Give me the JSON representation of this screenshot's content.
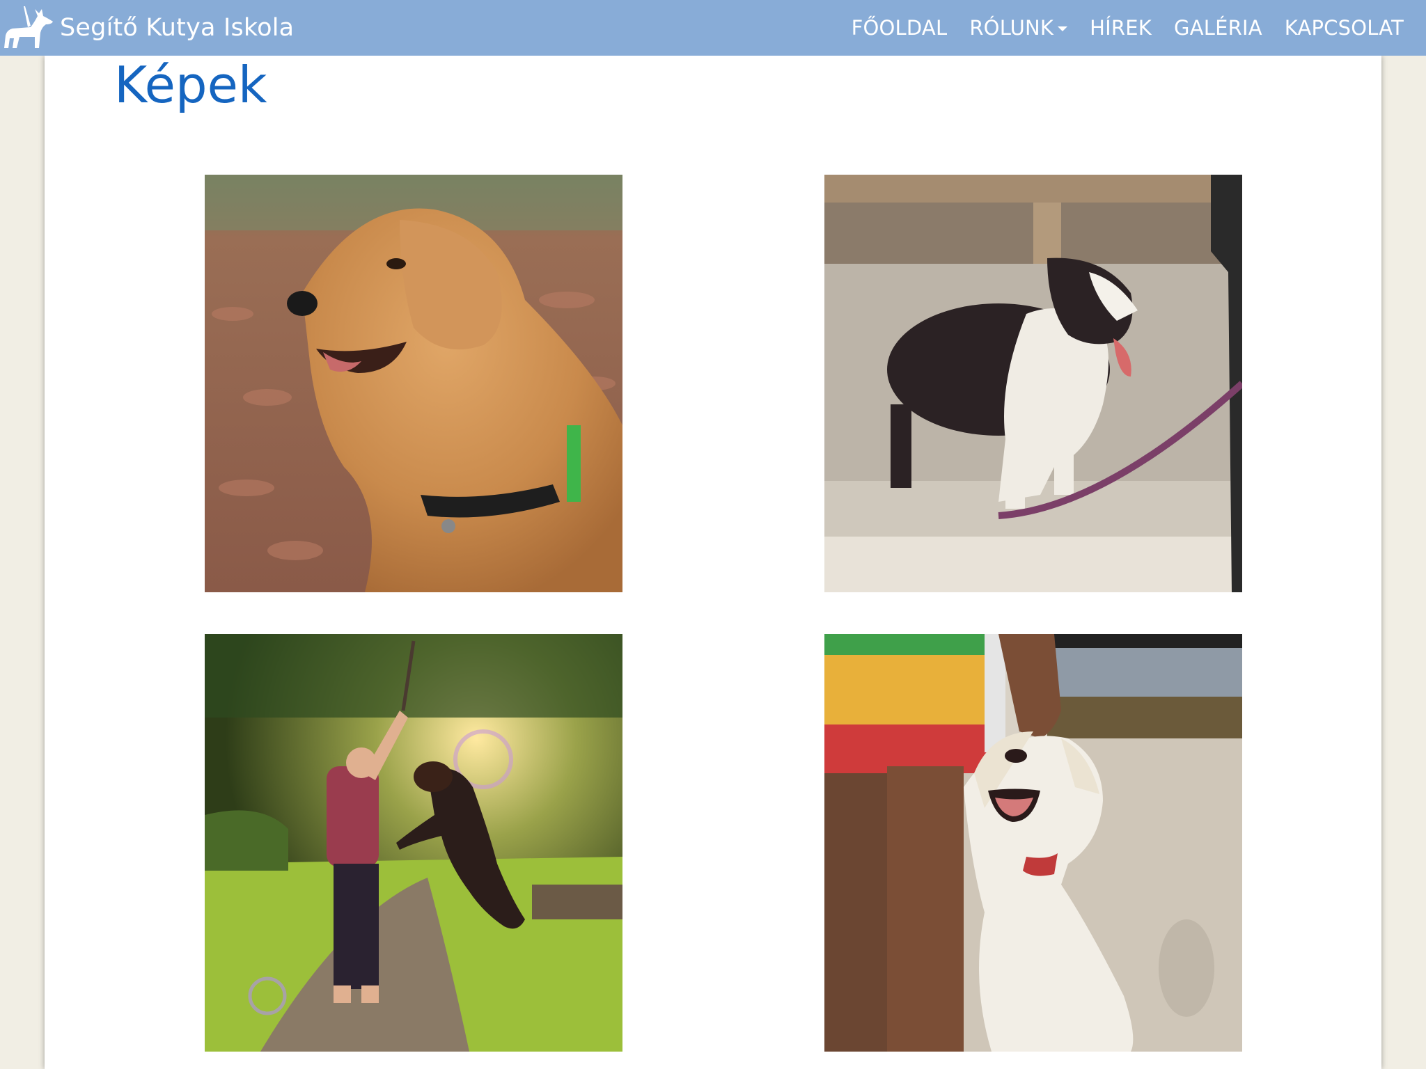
{
  "brand": {
    "name": "Segítő Kutya Iskola",
    "logo_icon": "dog-silhouette-icon"
  },
  "nav": {
    "items": [
      {
        "label": "FŐOLDAL"
      },
      {
        "label": "RÓLUNK",
        "has_dropdown": true
      },
      {
        "label": "HÍREK"
      },
      {
        "label": "GALÉRIA"
      },
      {
        "label": "KAPCSOLAT"
      }
    ]
  },
  "page": {
    "title": "Képek"
  },
  "gallery": {
    "images": [
      {
        "subject": "golden-retriever-in-autumn-leaves"
      },
      {
        "subject": "border-collie-on-leash"
      },
      {
        "subject": "man-playing-with-jumping-dog"
      },
      {
        "subject": "smiling-labrador"
      }
    ]
  },
  "colors": {
    "navbar": "#88acd7",
    "title": "#1565c0",
    "page_background": "#f1eee4"
  }
}
